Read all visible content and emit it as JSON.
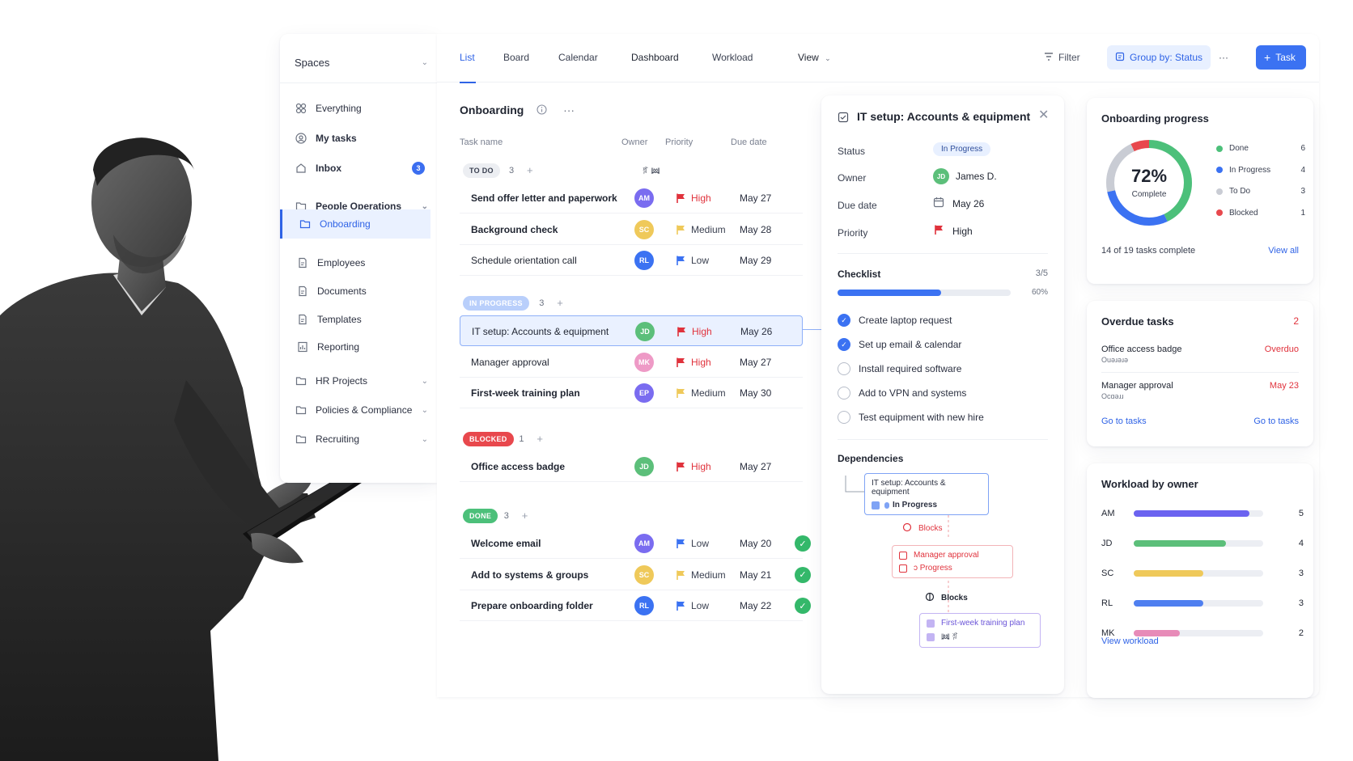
{
  "sidebar": {
    "header": "Spaces",
    "items": [
      {
        "label": "Everything",
        "icon": "grid-icon"
      },
      {
        "label": "My tasks",
        "icon": "user-circle-icon"
      },
      {
        "label": "Inbox",
        "icon": "inbox-icon",
        "badge": "3"
      },
      {
        "label": "People Operations",
        "icon": "folder-icon"
      },
      {
        "label": "Onboarding",
        "icon": "folder-icon"
      },
      {
        "label": "Employees",
        "icon": "document-icon"
      },
      {
        "label": "Documents",
        "icon": "document-icon"
      },
      {
        "label": "Templates",
        "icon": "document-icon"
      },
      {
        "label": "Reporting",
        "icon": "chart-icon"
      },
      {
        "label": "HR Projects",
        "icon": "folder-icon"
      },
      {
        "label": "Policies & Compliance",
        "icon": "folder-icon"
      },
      {
        "label": "Recruiting",
        "icon": "folder-icon"
      }
    ]
  },
  "topbar": {
    "tabs": [
      "List",
      "Board",
      "Calendar",
      "Dashboard",
      "Workload",
      "View"
    ],
    "filter": "Filter",
    "group_by": "Group by: Status",
    "more": "···",
    "new_task": "Task"
  },
  "list": {
    "title": "Onboarding",
    "more": "···",
    "columns": {
      "name": "Task name",
      "owner": "Owner",
      "priority": "Priority",
      "due": "Due date"
    },
    "groups": [
      {
        "tag": "TO DO",
        "count": "3",
        "extra": "ꂎ ꔞ",
        "rows": [
          {
            "name": "Send offer letter and paperwork",
            "owner": "AM",
            "priority": "High",
            "due": "May 27"
          },
          {
            "name": "Background check",
            "owner": "SC",
            "priority": "Medium",
            "due": "May 28"
          },
          {
            "name": "Schedule orientation call",
            "owner": "RL",
            "priority": "Low",
            "due": "May 29"
          }
        ]
      },
      {
        "tag": "IN PROGRESS",
        "count": "3",
        "rows": [
          {
            "name": "IT setup: Accounts & equipment",
            "owner": "JD",
            "priority": "High",
            "due": "May 26"
          },
          {
            "name": "Manager approval",
            "owner": "MK",
            "priority": "High",
            "due": "May 27"
          },
          {
            "name": "First-week training plan",
            "owner": "EP",
            "priority": "Medium",
            "due": "May 30"
          }
        ]
      },
      {
        "tag": "BLOCKED",
        "count": "1",
        "rows": [
          {
            "name": "Office access badge",
            "owner": "JD",
            "priority": "High",
            "due": "May 27"
          }
        ]
      },
      {
        "tag": "DONE",
        "count": "3",
        "rows": [
          {
            "name": "Welcome email",
            "owner": "AM",
            "priority": "Low",
            "due": "May 20"
          },
          {
            "name": "Add to systems & groups",
            "owner": "SC",
            "priority": "Medium",
            "due": "May 21"
          },
          {
            "name": "Prepare onboarding folder",
            "owner": "RL",
            "priority": "Low",
            "due": "May 22"
          }
        ]
      }
    ]
  },
  "detail": {
    "title": "IT setup: Accounts & equipment",
    "status_label": "Status",
    "status": "In Progress",
    "owner_label": "Owner",
    "owner_initials": "JD",
    "owner": "James D.",
    "due_label": "Due date",
    "due": "May 26",
    "priority_label": "Priority",
    "priority": "High",
    "checklist_label": "Checklist",
    "checklist_count": "3/5",
    "checklist_pct": "60%",
    "checklist_progress": 0.6,
    "checklist": [
      {
        "label": "Create laptop request",
        "done": true
      },
      {
        "label": "Set up email & calendar",
        "done": true
      },
      {
        "label": "Install required software",
        "done": false
      },
      {
        "label": "Add to VPN and systems",
        "done": false
      },
      {
        "label": "Test equipment with new hire",
        "done": false
      }
    ],
    "dependencies_label": "Dependencies",
    "dep1_title": "IT setup: Accounts & equipment",
    "dep1_status": "In Progress",
    "blocks1": "Blocks",
    "dep2_title": "Manager approval",
    "dep2_status": "ɔ Progress",
    "blocks2": "Blocks",
    "dep3_title": "First-week training plan",
    "dep3_status": "ꔞ ꂎ"
  },
  "progress": {
    "title": "Onboarding progress",
    "pct": "72%",
    "pct_label": "Complete",
    "summary": "14 of 19 tasks complete",
    "view_all": "View all",
    "legend": [
      {
        "label": "Done",
        "value": 6,
        "color": "#4cc07a"
      },
      {
        "label": "In Progress",
        "value": 4,
        "color": "#3b72f2"
      },
      {
        "label": "To Do",
        "value": 3,
        "color": "#c9ccd4"
      },
      {
        "label": "Blocked",
        "value": 1,
        "color": "#e8484d"
      }
    ]
  },
  "overdue": {
    "title": "Overdue tasks",
    "count": "2",
    "items": [
      {
        "name": "Office access badge",
        "sub": "Ouəɹəɹə",
        "status": "Overduo"
      },
      {
        "name": "Manager approval",
        "sub": "Ocɑəɹɹ",
        "status": "May 23"
      }
    ],
    "link_left": "Go to tasks",
    "link_right": "Go to tasks"
  },
  "workload": {
    "title": "Workload by owner",
    "rows": [
      {
        "owner": "AM",
        "value": 5,
        "color": "#6b63f0"
      },
      {
        "owner": "JD",
        "value": 4,
        "color": "#5cbf7a"
      },
      {
        "owner": "SC",
        "value": 3,
        "color": "#efc95a"
      },
      {
        "owner": "RL",
        "value": 3,
        "color": "#4f7ff0"
      },
      {
        "owner": "MK",
        "value": 2,
        "color": "#e78bb8"
      }
    ],
    "max": 5.6,
    "link": "View workload"
  },
  "colors": {
    "accent": "#3b72f2",
    "high": "#e0323c",
    "medium": "#efc95a",
    "low": "#3b72f2",
    "done": "#34b86a"
  }
}
